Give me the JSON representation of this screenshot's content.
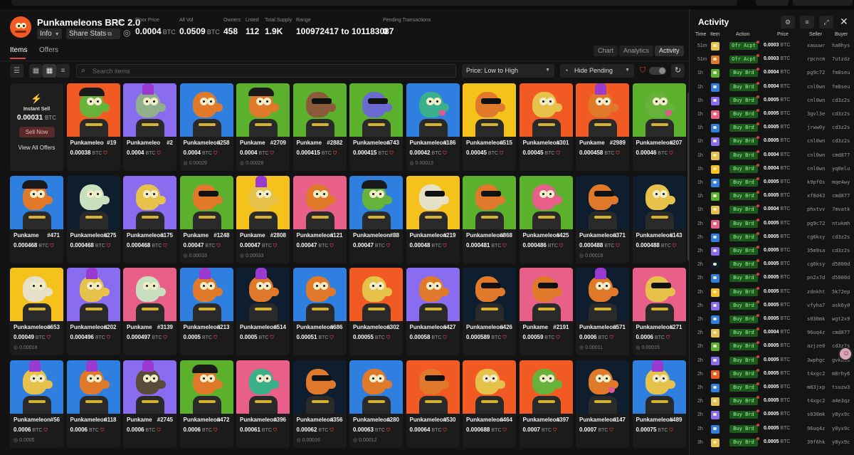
{
  "header": {
    "name": "Punkameleons BRC 2.0",
    "info": "Info",
    "share": "Share Stats",
    "stats": [
      {
        "label": "Floor Price",
        "value": "0.0004",
        "unit": "BTC"
      },
      {
        "label": "All Vol",
        "value": "0.0509",
        "unit": "BTC"
      },
      {
        "label": "Owners",
        "value": "458",
        "unit": ""
      },
      {
        "label": "Listed",
        "value": "112",
        "unit": ""
      },
      {
        "label": "Total Supply",
        "value": "1.9K",
        "unit": ""
      },
      {
        "label": "Range",
        "value": "100972417 to 101183087",
        "unit": ""
      },
      {
        "label": "Pending Transactions",
        "value": "0",
        "unit": ""
      }
    ]
  },
  "tabs": {
    "items": "Items",
    "offers": "Offers"
  },
  "view_tabs": [
    "Chart",
    "Analytics",
    "Activity"
  ],
  "filters": {
    "search_placeholder": "Search items",
    "sort": "Price: Low to High",
    "pending": "Hide Pending"
  },
  "instant_sell": {
    "title": "Instant Sell",
    "price": "0.00031",
    "unit": "BTC",
    "sell_label": "Sell Now",
    "view_all": "View All Offers"
  },
  "colors": {
    "palette": [
      "#f15a22",
      "#8a6cf0",
      "#2f7fe0",
      "#5bb02c",
      "#f5c21c",
      "#e8608a",
      "#0f1e2e",
      "#e77c1c"
    ]
  },
  "cards": [
    {
      "name": "Punkameleo",
      "num": "#19",
      "price": "0.00038",
      "last": "",
      "bg": "#f15a22",
      "skin": "#66b23a",
      "acc": "hat"
    },
    {
      "name": "Punkameleo",
      "num": "#2",
      "price": "0.0004",
      "last": "",
      "bg": "#8a6cf0",
      "skin": "#8fb08a",
      "acc": "mohawk"
    },
    {
      "name": "Punkameleon",
      "num": "#258",
      "price": "0.0004",
      "last": "0.00029",
      "bg": "#2f7fe0",
      "skin": "#e07a2a",
      "acc": "none"
    },
    {
      "name": "Punkame",
      "num": "#2709",
      "price": "0.0004",
      "last": "0.00028",
      "bg": "#5bb02c",
      "skin": "#e07a2a",
      "acc": "hat"
    },
    {
      "name": "Punkame",
      "num": "#2882",
      "price": "0.000415",
      "last": "",
      "bg": "#5bb02c",
      "skin": "#8a5a3a",
      "acc": "shades"
    },
    {
      "name": "Punkameleon",
      "num": "#743",
      "price": "0.000415",
      "last": "",
      "bg": "#5bb02c",
      "skin": "#6a6ad0",
      "acc": "shades"
    },
    {
      "name": "Punkameleon",
      "num": "#186",
      "price": "0.00042",
      "last": "0.00013",
      "bg": "#2f7fe0",
      "skin": "#3ab08a",
      "acc": "tongue"
    },
    {
      "name": "Punkameleon",
      "num": "#515",
      "price": "0.00045",
      "last": "",
      "bg": "#f5c21c",
      "skin": "#e07a2a",
      "acc": "shades"
    },
    {
      "name": "Punkameleon",
      "num": "#301",
      "price": "0.00045",
      "last": "",
      "bg": "#f15a22",
      "skin": "#e6c24a",
      "acc": "none"
    },
    {
      "name": "Punkame",
      "num": "#2989",
      "price": "0.000458",
      "last": "",
      "bg": "#f15a22",
      "skin": "#e07a2a",
      "acc": "mohawk"
    },
    {
      "name": "Punkameleon",
      "num": "#207",
      "price": "0.00046",
      "last": "",
      "bg": "#5bb02c",
      "skin": "#66b23a",
      "acc": "tongue"
    },
    {
      "name": "Punkame",
      "num": "#471",
      "price": "0.000468",
      "last": "",
      "bg": "#2f7fe0",
      "skin": "#e07a2a",
      "acc": "hat"
    },
    {
      "name": "Punkameleon",
      "num": "#275",
      "price": "0.000468",
      "last": "",
      "bg": "#0f1e2e",
      "skin": "#c8e0c0",
      "acc": "none"
    },
    {
      "name": "Punkameleon",
      "num": "#175",
      "price": "0.000468",
      "last": "",
      "bg": "#8a6cf0",
      "skin": "#e6c24a",
      "acc": "none"
    },
    {
      "name": "Punkame",
      "num": "#1248",
      "price": "0.00047",
      "last": "0.00033",
      "bg": "#5bb02c",
      "skin": "#e07a2a",
      "acc": "shades"
    },
    {
      "name": "Punkame",
      "num": "#2808",
      "price": "0.00047",
      "last": "0.00033",
      "bg": "#f5c21c",
      "skin": "#e6c24a",
      "acc": "mohawk"
    },
    {
      "name": "Punkameleon",
      "num": "#121",
      "price": "0.00047",
      "last": "",
      "bg": "#e8608a",
      "skin": "#e07a2a",
      "acc": "none"
    },
    {
      "name": "Punkameleon",
      "num": "#88",
      "price": "0.00047",
      "last": "",
      "bg": "#2f7fe0",
      "skin": "#66b23a",
      "acc": "hat"
    },
    {
      "name": "Punkameleon",
      "num": "#219",
      "price": "0.00048",
      "last": "",
      "bg": "#f5c21c",
      "skin": "#e6e0c8",
      "acc": "shades"
    },
    {
      "name": "Punkameleon",
      "num": "#868",
      "price": "0.000481",
      "last": "",
      "bg": "#5bb02c",
      "skin": "#e07a2a",
      "acc": "shades"
    },
    {
      "name": "Punkameleon",
      "num": "#425",
      "price": "0.000486",
      "last": "",
      "bg": "#5bb02c",
      "skin": "#e8608a",
      "acc": "none"
    },
    {
      "name": "Punkameleon",
      "num": "#371",
      "price": "0.000488",
      "last": "0.00018",
      "bg": "#0f1e2e",
      "skin": "#e07a2a",
      "acc": "shades"
    },
    {
      "name": "Punkameleon",
      "num": "#143",
      "price": "0.000488",
      "last": "",
      "bg": "#0f1e2e",
      "skin": "#e6c24a",
      "acc": "none"
    },
    {
      "name": "Punkameleon",
      "num": "#653",
      "price": "0.00049",
      "last": "0.00018",
      "bg": "#f5c21c",
      "skin": "#e6e0c8",
      "acc": "none"
    },
    {
      "name": "Punkameleon",
      "num": "#202",
      "price": "0.000496",
      "last": "",
      "bg": "#8a6cf0",
      "skin": "#e6c24a",
      "acc": "mohawk"
    },
    {
      "name": "Punkame",
      "num": "#3139",
      "price": "0.000497",
      "last": "",
      "bg": "#e8608a",
      "skin": "#c8e0c0",
      "acc": "none"
    },
    {
      "name": "Punkameleon",
      "num": "#213",
      "price": "0.0005",
      "last": "",
      "bg": "#2f7fe0",
      "skin": "#e07a2a",
      "acc": "mohawk"
    },
    {
      "name": "Punkameleon",
      "num": "#514",
      "price": "0.0005",
      "last": "",
      "bg": "#0f1e2e",
      "skin": "#e07a2a",
      "acc": "mohawk"
    },
    {
      "name": "Punkameleon",
      "num": "#686",
      "price": "0.00051",
      "last": "",
      "bg": "#2f7fe0",
      "skin": "#e07a2a",
      "acc": "none"
    },
    {
      "name": "Punkameleon",
      "num": "#302",
      "price": "0.00055",
      "last": "",
      "bg": "#f15a22",
      "skin": "#e6c24a",
      "acc": "none"
    },
    {
      "name": "Punkameleon",
      "num": "#427",
      "price": "0.00058",
      "last": "",
      "bg": "#8a6cf0",
      "skin": "#e07a2a",
      "acc": "none"
    },
    {
      "name": "Punkameleon",
      "num": "#426",
      "price": "0.000589",
      "last": "",
      "bg": "#0f1e2e",
      "skin": "#e07a2a",
      "acc": "shades"
    },
    {
      "name": "Punkame",
      "num": "#2191",
      "price": "0.00059",
      "last": "",
      "bg": "#e8608a",
      "skin": "#e07a2a",
      "acc": "shades"
    },
    {
      "name": "Punkameleon",
      "num": "#571",
      "price": "0.0006",
      "last": "0.00011",
      "bg": "#0f1e2e",
      "skin": "#e07a2a",
      "acc": "mohawk"
    },
    {
      "name": "Punkameleon",
      "num": "#271",
      "price": "0.0006",
      "last": "0.00015",
      "bg": "#e8608a",
      "skin": "#e6c24a",
      "acc": "shades"
    },
    {
      "name": "Punkameleon",
      "num": "#56",
      "price": "0.0006",
      "last": "0.0005",
      "bg": "#2f7fe0",
      "skin": "#e6c24a",
      "acc": "mohawk"
    },
    {
      "name": "Punkameleon",
      "num": "#118",
      "price": "0.0006",
      "last": "",
      "bg": "#2f7fe0",
      "skin": "#e07a2a",
      "acc": "mohawk"
    },
    {
      "name": "Punkame",
      "num": "#2745",
      "price": "0.0006",
      "last": "",
      "bg": "#8a6cf0",
      "skin": "#5a4a3a",
      "acc": "mohawk"
    },
    {
      "name": "Punkameleon",
      "num": "#472",
      "price": "0.0006",
      "last": "",
      "bg": "#5bb02c",
      "skin": "#e07a2a",
      "acc": "hat"
    },
    {
      "name": "Punkameleon",
      "num": "#396",
      "price": "0.00061",
      "last": "",
      "bg": "#e8608a",
      "skin": "#3ab08a",
      "acc": "none"
    },
    {
      "name": "Punkameleon",
      "num": "#356",
      "price": "0.00062",
      "last": "0.00016",
      "bg": "#0f1e2e",
      "skin": "#e07a2a",
      "acc": "shades"
    },
    {
      "name": "Punkameleon",
      "num": "#280",
      "price": "0.00063",
      "last": "0.00012",
      "bg": "#2f7fe0",
      "skin": "#e07a2a",
      "acc": "none"
    },
    {
      "name": "Punkameleon",
      "num": "#530",
      "price": "0.00064",
      "last": "",
      "bg": "#f15a22",
      "skin": "#e07a2a",
      "acc": "shades"
    },
    {
      "name": "Punkameleon",
      "num": "#464",
      "price": "0.000688",
      "last": "",
      "bg": "#f15a22",
      "skin": "#e6c24a",
      "acc": "none"
    },
    {
      "name": "Punkameleon",
      "num": "#397",
      "price": "0.0007",
      "last": "",
      "bg": "#f15a22",
      "skin": "#66b23a",
      "acc": "none"
    },
    {
      "name": "Punkameleon",
      "num": "#147",
      "price": "0.0007",
      "last": "",
      "bg": "#0f1e2e",
      "skin": "#e07a2a",
      "acc": "tongue"
    },
    {
      "name": "Punkameleon",
      "num": "#489",
      "price": "0.00075",
      "last": "",
      "bg": "#2f7fe0",
      "skin": "#e6c24a",
      "acc": "mohawk"
    }
  ],
  "activity": {
    "title": "Activity",
    "columns": {
      "time": "Time",
      "item": "Item",
      "action": "Action",
      "price": "Price",
      "seller": "Seller",
      "buyer": "Buyer"
    },
    "rows": [
      {
        "time": "51m",
        "action": "Ofr Acpt",
        "price": "0.0003",
        "seller": "xauuwr",
        "buyer": "ha0hys",
        "color": "#e6c24a"
      },
      {
        "time": "51m",
        "action": "Ofr Acpt",
        "price": "0.0003",
        "seller": "rpcncm",
        "buyer": "7utzdz",
        "color": "#e07a2a"
      },
      {
        "time": "1h",
        "action": "Buy Brd",
        "price": "0.0004",
        "seller": "pg9c72",
        "buyer": "fm8seu",
        "color": "#5bb02c"
      },
      {
        "time": "1h",
        "action": "Buy Brd",
        "price": "0.0004",
        "seller": "cnl0wn",
        "buyer": "fm8seu",
        "color": "#2f7fe0"
      },
      {
        "time": "1h",
        "action": "Buy Brd",
        "price": "0.0005",
        "seller": "cnl0wn",
        "buyer": "cd3z2s",
        "color": "#8a6cf0"
      },
      {
        "time": "1h",
        "action": "Buy Brd",
        "price": "0.0005",
        "seller": "3gvl3e",
        "buyer": "cd3z2s",
        "color": "#e8608a"
      },
      {
        "time": "1h",
        "action": "Buy Brd",
        "price": "0.0005",
        "seller": "jrww0y",
        "buyer": "cd3z2s",
        "color": "#2f7fe0"
      },
      {
        "time": "1h",
        "action": "Buy Brd",
        "price": "0.0005",
        "seller": "cnl0wn",
        "buyer": "cd3z2s",
        "color": "#8a6cf0"
      },
      {
        "time": "1h",
        "action": "Buy Brd",
        "price": "0.0004",
        "seller": "cnl0wn",
        "buyer": "cmd877",
        "color": "#e6c24a"
      },
      {
        "time": "1h",
        "action": "Buy Brd",
        "price": "0.0004",
        "seller": "cnl0wn",
        "buyer": "yq0elu",
        "color": "#f5c21c"
      },
      {
        "time": "1h",
        "action": "Buy Brd",
        "price": "0.0005",
        "seller": "k9pf0s",
        "buyer": "mqe4wy",
        "color": "#2f7fe0"
      },
      {
        "time": "1h",
        "action": "Buy Brd",
        "price": "0.0005",
        "seller": "xf8d43",
        "buyer": "cmd877",
        "color": "#5bb02c"
      },
      {
        "time": "1h",
        "action": "Buy Brd",
        "price": "0.0004",
        "seller": "phxtvv",
        "buyer": "7mvatk",
        "color": "#e6c24a"
      },
      {
        "time": "2h",
        "action": "Buy Brd",
        "price": "0.0005",
        "seller": "pg9c72",
        "buyer": "ntukmh",
        "color": "#e8608a"
      },
      {
        "time": "2h",
        "action": "Buy Brd",
        "price": "0.0005",
        "seller": "cg6ksy",
        "buyer": "cd3z2s",
        "color": "#2f7fe0"
      },
      {
        "time": "2h",
        "action": "Buy Brd",
        "price": "0.0005",
        "seller": "35m9sa",
        "buyer": "cd3z2s",
        "color": "#8a6cf0"
      },
      {
        "time": "2h",
        "action": "Buy Brd",
        "price": "0.0005",
        "seller": "cg6ksy",
        "buyer": "d5800d",
        "color": "#0f1e2e"
      },
      {
        "time": "2h",
        "action": "Buy Brd",
        "price": "0.0005",
        "seller": "pn2x7d",
        "buyer": "d5800d",
        "color": "#2f7fe0"
      },
      {
        "time": "2h",
        "action": "Buy Brd",
        "price": "0.0005",
        "seller": "zdnkht",
        "buyer": "5k72ep",
        "color": "#f5c21c"
      },
      {
        "time": "2h",
        "action": "Buy Brd",
        "price": "0.0005",
        "seller": "vfyha7",
        "buyer": "ask6y0",
        "color": "#8a6cf0"
      },
      {
        "time": "2h",
        "action": "Buy Brd",
        "price": "0.0005",
        "seller": "s030mk",
        "buyer": "wgt2x9",
        "color": "#2f7fe0"
      },
      {
        "time": "2h",
        "action": "Buy Brd",
        "price": "0.0004",
        "seller": "96uq4z",
        "buyer": "cmd877",
        "color": "#e6c24a"
      },
      {
        "time": "2h",
        "action": "Buy Brd",
        "price": "0.0005",
        "seller": "azjze0",
        "buyer": "cd3z2s",
        "color": "#5bb02c"
      },
      {
        "time": "2h",
        "action": "Buy Brd",
        "price": "0.0005",
        "seller": "3wphgc",
        "buyer": "gvkaus",
        "color": "#8a6cf0"
      },
      {
        "time": "2h",
        "action": "Buy Brd",
        "price": "0.0005",
        "seller": "t4xgc2",
        "buyer": "m8rhy6",
        "color": "#f15a22"
      },
      {
        "time": "2h",
        "action": "Buy Brd",
        "price": "0.0005",
        "seller": "m83jxp",
        "buyer": "tsuzw3",
        "color": "#2f7fe0"
      },
      {
        "time": "2h",
        "action": "Buy Brd",
        "price": "0.0005",
        "seller": "t4xgc2",
        "buyer": "a4e3qz",
        "color": "#e6c24a"
      },
      {
        "time": "2h",
        "action": "Buy Brd",
        "price": "0.0005",
        "seller": "s030mk",
        "buyer": "y8yx9c",
        "color": "#8a6cf0"
      },
      {
        "time": "2h",
        "action": "Buy Brd",
        "price": "0.0005",
        "seller": "96uq4z",
        "buyer": "y8yx9c",
        "color": "#2f7fe0"
      },
      {
        "time": "3h",
        "action": "Buy Brd",
        "price": "0.0005",
        "seller": "39f6hk",
        "buyer": "y8yx9c",
        "color": "#e6c24a"
      }
    ]
  }
}
